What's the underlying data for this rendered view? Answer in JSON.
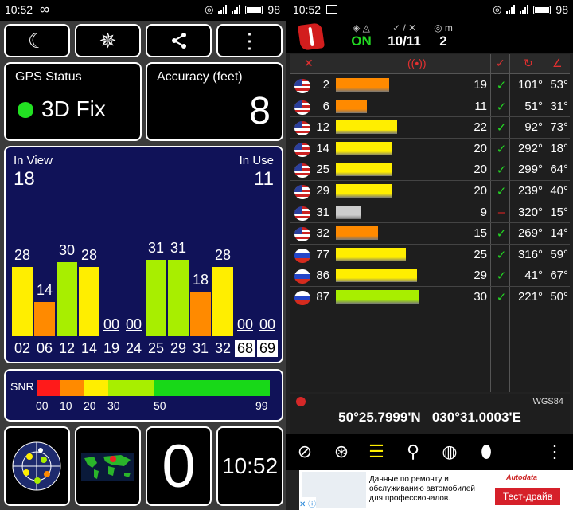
{
  "left": {
    "status_bar": {
      "time": "10:52",
      "infinity": "∞",
      "battery": "98"
    },
    "toolbar": [
      {
        "name": "night-mode-button",
        "icon": "moon-icon",
        "glyph": "☾"
      },
      {
        "name": "compass-rose-button",
        "icon": "compass-star-icon",
        "glyph": "✵"
      },
      {
        "name": "share-button",
        "icon": "share-icon",
        "glyph": "⋖"
      },
      {
        "name": "overflow-menu-button",
        "icon": "overflow-menu-icon",
        "glyph": "⋮"
      }
    ],
    "gps_status": {
      "label": "GPS Status",
      "value": "3D Fix"
    },
    "accuracy": {
      "label": "Accuracy (feet)",
      "value": "8"
    },
    "satellites": {
      "in_view_label": "In View",
      "in_view": "18",
      "in_use_label": "In Use",
      "in_use": "11"
    },
    "snr_legend": {
      "label": "SNR",
      "ticks": [
        "00",
        "10",
        "20",
        "30",
        "50",
        "99"
      ]
    },
    "bottom_buttons": {
      "clock": "10:52",
      "counter": "0"
    }
  },
  "chart_data": {
    "type": "bar",
    "categories": [
      "02",
      "06",
      "12",
      "14",
      "19",
      "24",
      "25",
      "29",
      "31",
      "32",
      "68",
      "69"
    ],
    "values": [
      28,
      14,
      30,
      28,
      0,
      0,
      31,
      31,
      18,
      28,
      0,
      0
    ],
    "value_labels": [
      "28",
      "14",
      "30",
      "28",
      "00",
      "00",
      "31",
      "31",
      "18",
      "28",
      "00",
      "00"
    ],
    "boxed_categories": [
      "68",
      "69"
    ],
    "colors": [
      "#ffee00",
      "#ff8a00",
      "#a8ee00",
      "#ffee00",
      "#ffffff",
      "#ffffff",
      "#a8ee00",
      "#a8ee00",
      "#ff8a00",
      "#ffee00",
      "#ffffff",
      "#ffffff"
    ],
    "ylim": [
      0,
      40
    ]
  },
  "right": {
    "status_bar": {
      "time": "10:52",
      "battery": "98"
    },
    "header": {
      "gps_on": "ON",
      "used_total": "10/11",
      "count": "2",
      "count_caption": "m"
    },
    "table_rows": [
      {
        "flag": "us",
        "prn": "2",
        "snr": 19,
        "color": "#ff8a00",
        "check": "✓",
        "azimuth": "101°",
        "elevation": "53°"
      },
      {
        "flag": "us",
        "prn": "6",
        "snr": 11,
        "color": "#ff8a00",
        "check": "✓",
        "azimuth": "51°",
        "elevation": "31°"
      },
      {
        "flag": "us",
        "prn": "12",
        "snr": 22,
        "color": "#ffee00",
        "check": "✓",
        "azimuth": "92°",
        "elevation": "73°"
      },
      {
        "flag": "us",
        "prn": "14",
        "snr": 20,
        "color": "#ffee00",
        "check": "✓",
        "azimuth": "292°",
        "elevation": "18°"
      },
      {
        "flag": "us",
        "prn": "25",
        "snr": 20,
        "color": "#ffee00",
        "check": "✓",
        "azimuth": "299°",
        "elevation": "64°"
      },
      {
        "flag": "us",
        "prn": "29",
        "snr": 20,
        "color": "#ffee00",
        "check": "✓",
        "azimuth": "239°",
        "elevation": "40°"
      },
      {
        "flag": "us",
        "prn": "31",
        "snr": 9,
        "color": "#cccccc",
        "check": "–",
        "azimuth": "320°",
        "elevation": "15°"
      },
      {
        "flag": "us",
        "prn": "32",
        "snr": 15,
        "color": "#ff8a00",
        "check": "✓",
        "azimuth": "269°",
        "elevation": "14°"
      },
      {
        "flag": "ru",
        "prn": "77",
        "snr": 25,
        "color": "#ffee00",
        "check": "✓",
        "azimuth": "316°",
        "elevation": "59°"
      },
      {
        "flag": "ru",
        "prn": "86",
        "snr": 29,
        "color": "#ffee00",
        "check": "✓",
        "azimuth": "41°",
        "elevation": "67°"
      },
      {
        "flag": "ru",
        "prn": "87",
        "snr": 30,
        "color": "#a8ee00",
        "check": "✓",
        "azimuth": "221°",
        "elevation": "50°"
      }
    ],
    "coordinates": {
      "datum": "WGS84",
      "lat": "50°25.7999'N",
      "lon": "030°31.0003'E"
    },
    "ad": {
      "text": "Данные по ремонту и обслуживанию автомобилей для профессионалов.",
      "brand": "Autodata",
      "cta": "Тест-драйв"
    }
  }
}
